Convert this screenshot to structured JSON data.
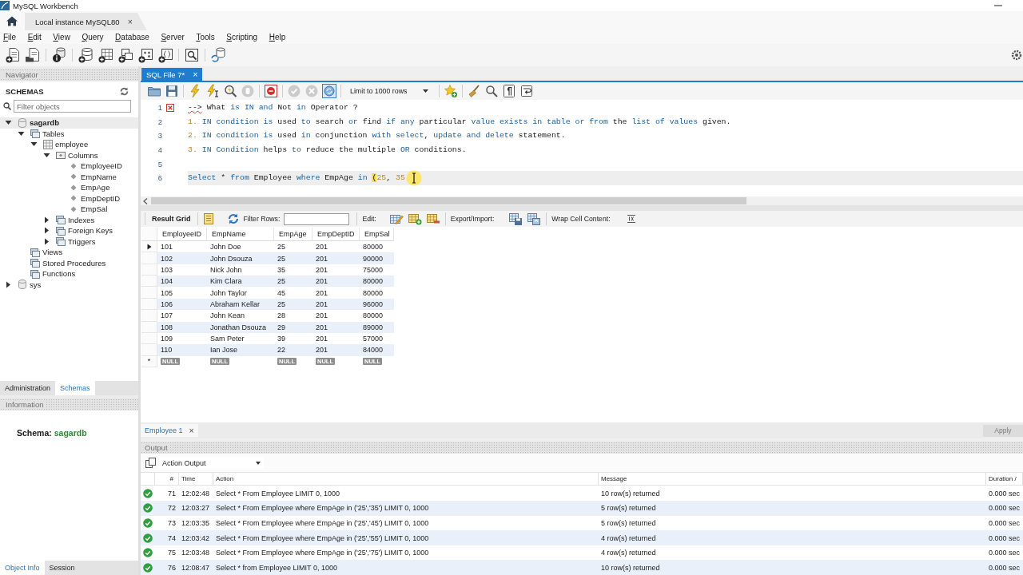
{
  "window": {
    "title": "MySQL Workbench"
  },
  "connection_tabs": [
    {
      "label": "Local instance MySQL80",
      "close": "×",
      "selected": true
    }
  ],
  "menu": [
    "File",
    "Edit",
    "View",
    "Query",
    "Database",
    "Server",
    "Tools",
    "Scripting",
    "Help"
  ],
  "navigator": {
    "title": "Navigator",
    "heading": "SCHEMAS",
    "filter": {
      "placeholder": "Filter objects"
    },
    "tree": [
      {
        "label": "sagardb",
        "kind": "schema",
        "default_schema": true,
        "expandable": true,
        "expanded": true,
        "selected": true,
        "children": [
          {
            "label": "Tables",
            "kind": "folder",
            "expandable": true,
            "expanded": true,
            "selected": false,
            "children": [
              {
                "label": "employee",
                "kind": "table",
                "expandable": true,
                "expanded": true,
                "selected": false,
                "children": [
                  {
                    "label": "Columns",
                    "kind": "columns",
                    "expandable": true,
                    "expanded": true,
                    "selected": false,
                    "children": [
                      {
                        "label": "EmployeeID",
                        "kind": "column",
                        "expandable": false,
                        "selected": false
                      },
                      {
                        "label": "EmpName",
                        "kind": "column",
                        "expandable": false,
                        "selected": false
                      },
                      {
                        "label": "EmpAge",
                        "kind": "column",
                        "expandable": false,
                        "selected": false
                      },
                      {
                        "label": "EmpDeptID",
                        "kind": "column",
                        "expandable": false,
                        "selected": false
                      },
                      {
                        "label": "EmpSal",
                        "kind": "column",
                        "expandable": false,
                        "selected": false
                      }
                    ]
                  },
                  {
                    "label": "Indexes",
                    "kind": "folder",
                    "expandable": true,
                    "expanded": false,
                    "selected": false
                  },
                  {
                    "label": "Foreign Keys",
                    "kind": "folder",
                    "expandable": true,
                    "expanded": false,
                    "selected": false
                  },
                  {
                    "label": "Triggers",
                    "kind": "folder",
                    "expandable": true,
                    "expanded": false,
                    "selected": false
                  }
                ]
              }
            ]
          },
          {
            "label": "Views",
            "kind": "folder",
            "expandable": false,
            "selected": false
          },
          {
            "label": "Stored Procedures",
            "kind": "folder",
            "expandable": false,
            "selected": false
          },
          {
            "label": "Functions",
            "kind": "folder",
            "expandable": false,
            "selected": false
          }
        ]
      },
      {
        "label": "sys",
        "kind": "schema",
        "default_schema": false,
        "expandable": true,
        "expanded": false,
        "selected": false
      }
    ],
    "tabs": [
      {
        "label": "Administration",
        "selected": false
      },
      {
        "label": "Schemas",
        "selected": true
      }
    ]
  },
  "information": {
    "title": "Information",
    "label": "Schema:",
    "value": "sagardb",
    "tabs": [
      {
        "label": "Object Info",
        "selected": true
      },
      {
        "label": "Session",
        "selected": false
      }
    ]
  },
  "editor": {
    "tabs": [
      {
        "label": "SQL File 7*",
        "close": "×",
        "selected": true
      }
    ],
    "toolbar": {
      "stop_disabled": true,
      "commit_disabled": true,
      "rollback_disabled": true,
      "autocommit": true,
      "limit": "Limit to 1000 rows"
    },
    "lines": [
      {
        "number": "1",
        "error": true,
        "current": false,
        "cursor": false,
        "tokens": [
          {
            "text": "-->",
            "kind": "error"
          },
          {
            "text": " What ",
            "kind": "text"
          },
          {
            "text": "is IN and ",
            "kind": "keyword"
          },
          {
            "text": "Not ",
            "kind": "text"
          },
          {
            "text": "in ",
            "kind": "keyword"
          },
          {
            "text": "Operator ?",
            "kind": "text"
          }
        ]
      },
      {
        "number": "2",
        "error": false,
        "current": false,
        "cursor": false,
        "tokens": [
          {
            "text": "1. ",
            "kind": "number"
          },
          {
            "text": "IN condition is ",
            "kind": "keyword"
          },
          {
            "text": "used ",
            "kind": "text"
          },
          {
            "text": "to ",
            "kind": "keyword"
          },
          {
            "text": "search ",
            "kind": "text"
          },
          {
            "text": "or ",
            "kind": "keyword"
          },
          {
            "text": "find ",
            "kind": "text"
          },
          {
            "text": "if any ",
            "kind": "keyword"
          },
          {
            "text": "particular ",
            "kind": "text"
          },
          {
            "text": "value exists in table or from ",
            "kind": "keyword"
          },
          {
            "text": "the ",
            "kind": "text"
          },
          {
            "text": "list of values ",
            "kind": "keyword"
          },
          {
            "text": "given.",
            "kind": "text"
          }
        ]
      },
      {
        "number": "3",
        "error": false,
        "current": false,
        "cursor": false,
        "tokens": [
          {
            "text": "2. ",
            "kind": "number"
          },
          {
            "text": "IN condition is ",
            "kind": "keyword"
          },
          {
            "text": "used ",
            "kind": "text"
          },
          {
            "text": "in ",
            "kind": "keyword"
          },
          {
            "text": "conjunction ",
            "kind": "text"
          },
          {
            "text": "with select",
            "kind": "keyword"
          },
          {
            "text": ", ",
            "kind": "text"
          },
          {
            "text": "update and delete ",
            "kind": "keyword"
          },
          {
            "text": "statement.",
            "kind": "text"
          }
        ]
      },
      {
        "number": "4",
        "error": false,
        "current": false,
        "cursor": false,
        "tokens": [
          {
            "text": "3. ",
            "kind": "number"
          },
          {
            "text": "IN Condition ",
            "kind": "keyword"
          },
          {
            "text": "helps ",
            "kind": "text"
          },
          {
            "text": "to ",
            "kind": "keyword"
          },
          {
            "text": "reduce the multiple ",
            "kind": "text"
          },
          {
            "text": "OR ",
            "kind": "keyword"
          },
          {
            "text": "conditions.",
            "kind": "text"
          }
        ]
      },
      {
        "number": "5",
        "error": false,
        "current": false,
        "cursor": false
      },
      {
        "number": "6",
        "error": false,
        "current": true,
        "cursor": true,
        "tokens": [
          {
            "text": "Select",
            "kind": "keyword"
          },
          {
            "text": " * ",
            "kind": "text"
          },
          {
            "text": "from",
            "kind": "keyword"
          },
          {
            "text": " Employee ",
            "kind": "text"
          },
          {
            "text": "where",
            "kind": "keyword"
          },
          {
            "text": " EmpAge ",
            "kind": "text"
          },
          {
            "text": "in ",
            "kind": "keyword"
          },
          {
            "text": "(",
            "kind": "bracket"
          },
          {
            "text": "25",
            "kind": "number"
          },
          {
            "text": ", ",
            "kind": "text"
          },
          {
            "text": "35",
            "kind": "number"
          }
        ]
      }
    ]
  },
  "result": {
    "toolbar": {
      "view": "Result Grid",
      "filter_label": "Filter Rows:",
      "edit_label": "Edit:",
      "export_label": "Export/Import:",
      "wrap_label": "Wrap Cell Content:"
    },
    "columns": [
      "EmployeeID",
      "EmpName",
      "EmpAge",
      "EmpDeptID",
      "EmpSal"
    ],
    "rows": [
      {
        "selected": true,
        "cells": [
          "101",
          "John Doe",
          "25",
          "201",
          "80000"
        ]
      },
      {
        "selected": false,
        "cells": [
          "102",
          "John Dsouza",
          "25",
          "201",
          "90000"
        ]
      },
      {
        "selected": false,
        "cells": [
          "103",
          "Nick John",
          "35",
          "201",
          "75000"
        ]
      },
      {
        "selected": false,
        "cells": [
          "104",
          "Kim Clara",
          "25",
          "201",
          "80000"
        ]
      },
      {
        "selected": false,
        "cells": [
          "105",
          "John Taylor",
          "45",
          "201",
          "80000"
        ]
      },
      {
        "selected": false,
        "cells": [
          "106",
          "Abraham Kellar",
          "25",
          "201",
          "96000"
        ]
      },
      {
        "selected": false,
        "cells": [
          "107",
          "John Kean",
          "28",
          "201",
          "80000"
        ]
      },
      {
        "selected": false,
        "cells": [
          "108",
          "Jonathan Dsouza",
          "29",
          "201",
          "89000"
        ]
      },
      {
        "selected": false,
        "cells": [
          "109",
          "Sam Peter",
          "39",
          "201",
          "57000"
        ]
      },
      {
        "selected": false,
        "cells": [
          "110",
          "Ian Jose",
          "22",
          "201",
          "84000"
        ]
      }
    ],
    "null_row": {
      "marker": "*",
      "cells": [
        "NULL",
        "NULL",
        "NULL",
        "NULL",
        "NULL"
      ]
    },
    "tabs": [
      {
        "label": "Employee 1",
        "close": "×",
        "selected": true
      }
    ],
    "apply": {
      "label": "Apply",
      "disabled": true
    }
  },
  "output": {
    "title": "Output",
    "mode": "Action Output",
    "columns": [
      "#",
      "Time",
      "Action",
      "Message",
      "Duration /"
    ],
    "rows": [
      {
        "success": true,
        "number": "71",
        "time": "12:02:48",
        "action": "Select * From Employee LIMIT 0, 1000",
        "message": "10 row(s) returned",
        "duration": "0.000 sec"
      },
      {
        "success": true,
        "number": "72",
        "time": "12:03:27",
        "action": "Select * From Employee where EmpAge in ('25','35') LIMIT 0, 1000",
        "message": "5 row(s) returned",
        "duration": "0.000 sec"
      },
      {
        "success": true,
        "number": "73",
        "time": "12:03:35",
        "action": "Select * From Employee where EmpAge in ('25','45') LIMIT 0, 1000",
        "message": "5 row(s) returned",
        "duration": "0.000 sec"
      },
      {
        "success": true,
        "number": "74",
        "time": "12:03:42",
        "action": "Select * From Employee where EmpAge in ('25','55') LIMIT 0, 1000",
        "message": "4 row(s) returned",
        "duration": "0.000 sec"
      },
      {
        "success": true,
        "number": "75",
        "time": "12:03:48",
        "action": "Select * From Employee where EmpAge in ('25','75') LIMIT 0, 1000",
        "message": "4 row(s) returned",
        "duration": "0.000 sec"
      },
      {
        "success": true,
        "number": "76",
        "time": "12:08:47",
        "action": "Select * from Employee LIMIT 0, 1000",
        "message": "10 row(s) returned",
        "duration": "0.000 sec"
      }
    ]
  }
}
